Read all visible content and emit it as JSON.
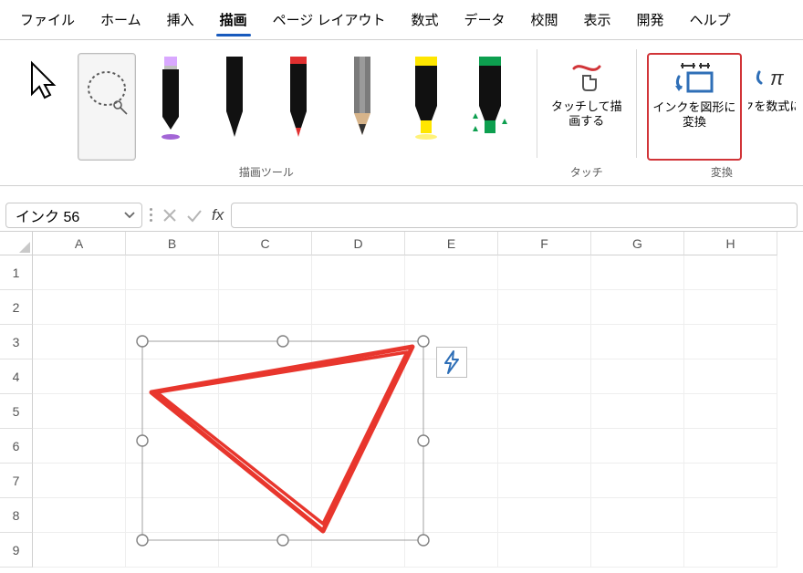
{
  "menu": {
    "tabs": [
      "ファイル",
      "ホーム",
      "挿入",
      "描画",
      "ページ レイアウト",
      "数式",
      "データ",
      "校閲",
      "表示",
      "開発",
      "ヘルプ"
    ],
    "active_index": 3
  },
  "ribbon": {
    "draw_tools_label": "描画ツール",
    "touch_group_label": "タッチ",
    "convert_group_label": "変換",
    "touch_button": "タッチして描画する",
    "ink_to_shape": "インクを図形に変換",
    "ink_to_formula": "インクを数式に変換",
    "pens": [
      "purple-eraser",
      "black-pen",
      "red-pen",
      "gray-pencil",
      "yellow-highlighter",
      "green-action-pen"
    ]
  },
  "formula_bar": {
    "name_box_value": "インク 56",
    "fx_label": "fx",
    "formula_value": ""
  },
  "grid": {
    "columns": [
      "A",
      "B",
      "C",
      "D",
      "E",
      "F",
      "G",
      "H"
    ],
    "rows": [
      "1",
      "2",
      "3",
      "4",
      "5",
      "6",
      "7",
      "8",
      "9"
    ]
  },
  "selection": {
    "object_name": "ink-triangle",
    "bbox_label": "selected-ink"
  }
}
